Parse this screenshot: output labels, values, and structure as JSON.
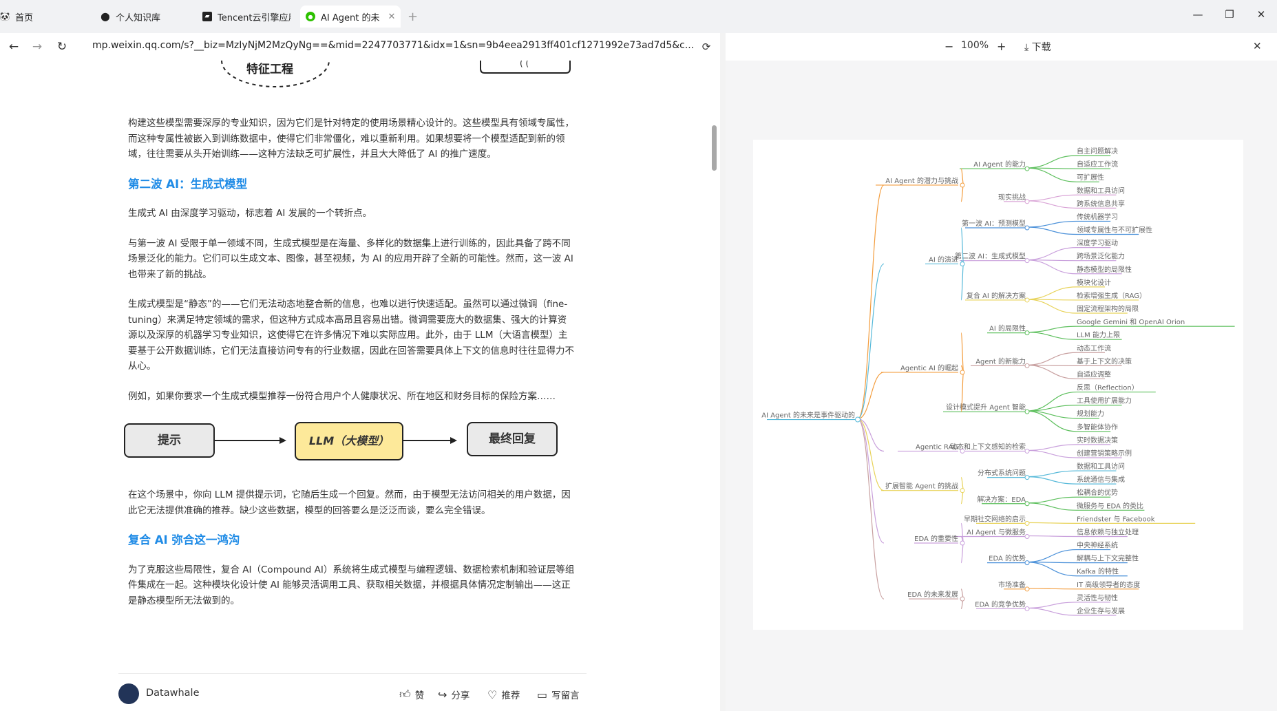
{
  "tabs": [
    {
      "label": "首页",
      "icon": "panda-icon"
    },
    {
      "label": "个人知识库",
      "icon": "location-pin-icon"
    },
    {
      "label": "Tencent云引擎应用",
      "icon": "app-logo-icon"
    },
    {
      "label": "AI Agent 的未",
      "icon": "wechat-icon"
    }
  ],
  "new_tab_symbol": "+",
  "address": {
    "url": "mp.weixin.qq.com/s?__biz=MzIyNjM2MzQyNg==&mid=2247703771&idx=1&sn=9b4eea2913ff401cf1271992e73ad7d5&c..."
  },
  "article": {
    "top_diagram_label": "特征工程",
    "para1": "构建这些模型需要深厚的专业知识，因为它们是针对特定的使用场景精心设计的。这些模型具有领域专属性，而这种专属性被嵌入到训练数据中，使得它们非常僵化，难以重新利用。如果想要将一个模型适配到新的领域，往往需要从头开始训练——这种方法缺乏可扩展性，并且大大降低了 AI 的推广速度。",
    "heading2": "第二波 AI：生成式模型",
    "para2": "生成式 AI 由深度学习驱动，标志着 AI 发展的一个转折点。",
    "para3": "与第一波 AI 受限于单一领域不同，生成式模型是在海量、多样化的数据集上进行训练的，因此具备了跨不同场景泛化的能力。它们可以生成文本、图像，甚至视频，为 AI 的应用开辟了全新的可能性。然而，这一波 AI 也带来了新的挑战。",
    "para4": "生成式模型是“静态”的——它们无法动态地整合新的信息，也难以进行快速适配。虽然可以通过微调（fine-tuning）来满足特定领域的需求，但这种方式成本高昂且容易出错。微调需要庞大的数据集、强大的计算资源以及深厚的机器学习专业知识，这使得它在许多情况下难以实际应用。此外，由于 LLM（大语言模型）主要基于公开数据训练，它们无法直接访问专有的行业数据，因此在回答需要具体上下文的信息时往往显得力不从心。",
    "para5": "例如，如果你要求一个生成式模型推荐一份符合用户个人健康状况、所在地区和财务目标的保险方案……",
    "flow": {
      "box1": "提示",
      "box2": "LLM（大模型）",
      "box3": "最终回复"
    },
    "para6": "在这个场景中，你向 LLM 提供提示词，它随后生成一个回复。然而，由于模型无法访问相关的用户数据，因此它无法提供准确的推荐。缺少这些数据，模型的回答要么是泛泛而谈，要么完全错误。",
    "heading3": "复合 AI 弥合这一鸿沟",
    "para7": "为了克服这些局限性，复合 AI（Compound AI）系统将生成式模型与编程逻辑、数据检索机制和验证层等组件集成在一起。这种模块化设计使 AI 能够灵活调用工具、获取相关数据，并根据具体情况定制输出——这正是静态模型所无法做到的。"
  },
  "bottom": {
    "account": "Datawhale",
    "like": "赞",
    "share": "分享",
    "recommend": "推荐",
    "comment": "写留言"
  },
  "viewer": {
    "zoom": "100%",
    "minus": "−",
    "plus": "+",
    "download": "下载"
  },
  "mindmap": {
    "root": "AI Agent 的未来是事件驱动的",
    "branches": [
      {
        "label": "AI Agent 的潜力与挑战",
        "color": "#f39c3c",
        "children": [
          {
            "label": "AI Agent 的能力",
            "color": "#5cbf5c",
            "leaves": [
              "自主问题解决",
              "自适应工作流",
              "可扩展性"
            ]
          },
          {
            "label": "现实挑战",
            "color": "#d9a3d6",
            "leaves": [
              "数据和工具访问",
              "跨系统信息共享"
            ]
          }
        ]
      },
      {
        "label": "AI 的演进",
        "color": "#56b9d9",
        "children": [
          {
            "label": "第一波 AI：预测模型",
            "color": "#4a90d9",
            "leaves": [
              "传统机器学习",
              "领域专属性与不可扩展性"
            ]
          },
          {
            "label": "第二波 AI：生成式模型",
            "color": "#c9a0dc",
            "leaves": [
              "深度学习驱动",
              "跨场景泛化能力",
              "静态模型的局限性"
            ]
          },
          {
            "label": "复合 AI 的解决方案",
            "color": "#e8d35a",
            "leaves": [
              "模块化设计",
              "检索增强生成（RAG）",
              "固定流程架构的局限"
            ]
          }
        ]
      },
      {
        "label": "Agentic AI 的崛起",
        "color": "#f39c3c",
        "children": [
          {
            "label": "AI 的局限性",
            "color": "#5cbf5c",
            "leaves": [
              "Google Gemini 和 OpenAI Orion",
              "LLM 能力上限"
            ]
          },
          {
            "label": "Agent 的新能力",
            "color": "#c8a0a0",
            "leaves": [
              "动态工作流",
              "基于上下文的决策",
              "自适应调整"
            ]
          },
          {
            "label": "设计模式提升 Agent 智能",
            "color": "#5cbf5c",
            "leaves": [
              "反思（Reflection）",
              "工具使用扩展能力",
              "规划能力",
              "多智能体协作"
            ]
          }
        ]
      },
      {
        "label": "Agentic RAG",
        "color": "#c9a0dc",
        "children": [
          {
            "label": "动态和上下文感知的检索",
            "color": "#c9a0dc",
            "leaves": [
              "实时数据决策",
              "创建营销策略示例"
            ]
          }
        ]
      },
      {
        "label": "扩展智能 Agent 的挑战",
        "color": "#e8d35a",
        "children": [
          {
            "label": "分布式系统问题",
            "color": "#56b9d9",
            "leaves": [
              "数据和工具访问",
              "系统通信与集成"
            ]
          },
          {
            "label": "解决方案：EDA",
            "color": "#5cbf5c",
            "leaves": [
              "松耦合的优势",
              "微服务与 EDA 的类比"
            ]
          }
        ]
      },
      {
        "label": "EDA 的重要性",
        "color": "#c9a0dc",
        "children": [
          {
            "label": "早期社交网络的启示",
            "color": "#e8d35a",
            "leaves": [
              "Friendster 与 Facebook"
            ]
          },
          {
            "label": "AI Agent 与微服务",
            "color": "#c9a0dc",
            "leaves": [
              "信息依赖与独立处理"
            ]
          },
          {
            "label": "EDA 的优势",
            "color": "#4a90d9",
            "leaves": [
              "中央神经系统",
              "解耦与上下文完整性",
              "Kafka 的特性"
            ]
          }
        ]
      },
      {
        "label": "EDA 的未来发展",
        "color": "#c8a0a0",
        "children": [
          {
            "label": "市场准备",
            "color": "#f39c3c",
            "leaves": [
              "IT 高级领导者的态度"
            ]
          },
          {
            "label": "EDA 的竞争优势",
            "color": "#c9a0dc",
            "leaves": [
              "灵活性与韧性",
              "企业生存与发展"
            ]
          }
        ]
      }
    ]
  },
  "colors": {
    "accent_blue": "#1f8be6",
    "flow_highlight": "#fde99a"
  }
}
